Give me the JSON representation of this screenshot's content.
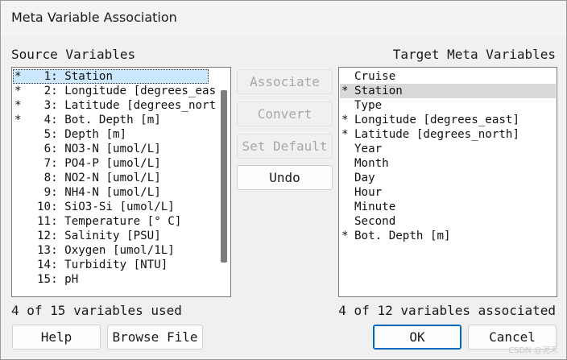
{
  "window": {
    "title": "Meta Variable Association"
  },
  "source": {
    "label": "Source Variables",
    "items": [
      {
        "mark": "*",
        "label": "1: Station"
      },
      {
        "mark": "*",
        "label": "2: Longitude [degrees_eas"
      },
      {
        "mark": "*",
        "label": "3: Latitude [degrees_nort"
      },
      {
        "mark": "*",
        "label": "4: Bot. Depth [m]"
      },
      {
        "mark": "",
        "label": "5: Depth [m]"
      },
      {
        "mark": "",
        "label": "6: NO3-N [umol/L]"
      },
      {
        "mark": "",
        "label": "7: PO4-P [umol/L]"
      },
      {
        "mark": "",
        "label": "8: NO2-N [umol/L]"
      },
      {
        "mark": "",
        "label": "9: NH4-N [umol/L]"
      },
      {
        "mark": "",
        "label": "10: SiO3-Si [umol/L]"
      },
      {
        "mark": "",
        "label": "11: Temperature [° C]"
      },
      {
        "mark": "",
        "label": "12: Salinity [PSU]"
      },
      {
        "mark": "",
        "label": "13: Oxygen [umol/1L]"
      },
      {
        "mark": "",
        "label": "14: Turbidity [NTU]"
      },
      {
        "mark": "",
        "label": "15: pH"
      }
    ],
    "status": "4 of 15 variables used"
  },
  "target": {
    "label": "Target Meta Variables",
    "items": [
      {
        "mark": "",
        "label": "Cruise"
      },
      {
        "mark": "*",
        "label": "Station"
      },
      {
        "mark": "",
        "label": "Type"
      },
      {
        "mark": "*",
        "label": "Longitude [degrees_east]"
      },
      {
        "mark": "*",
        "label": "Latitude [degrees_north]"
      },
      {
        "mark": "",
        "label": "Year"
      },
      {
        "mark": "",
        "label": "Month"
      },
      {
        "mark": "",
        "label": "Day"
      },
      {
        "mark": "",
        "label": "Hour"
      },
      {
        "mark": "",
        "label": "Minute"
      },
      {
        "mark": "",
        "label": "Second"
      },
      {
        "mark": "*",
        "label": "Bot. Depth [m]"
      }
    ],
    "status": "4 of 12 variables associated"
  },
  "actions": {
    "associate": "Associate",
    "convert": "Convert",
    "set_default": "Set Default",
    "undo": "Undo"
  },
  "footer": {
    "help": "Help",
    "browse_file": "Browse File",
    "ok": "OK",
    "cancel": "Cancel"
  },
  "watermark": "CSDN @泥禾"
}
